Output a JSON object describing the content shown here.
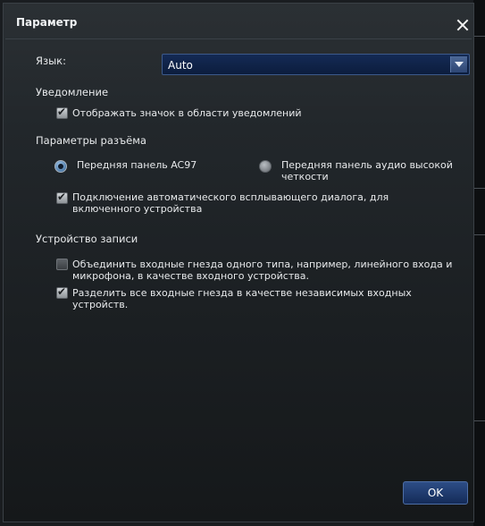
{
  "window": {
    "title": "Параметр"
  },
  "language": {
    "label": "Язык:",
    "selected": "Auto"
  },
  "notifications": {
    "heading": "Уведомление",
    "show_tray_icon": {
      "label": "Отображать значок в области уведомлений",
      "checked": true
    }
  },
  "jack_settings": {
    "heading": "Параметры разъёма",
    "front_ac97": {
      "label": "Передняя панель AC97",
      "selected": true
    },
    "front_hd": {
      "label": "Передняя панель аудио высокой четкости",
      "selected": false
    },
    "auto_popup": {
      "label": "Подключение автоматического всплывающего диалога, для включенного устройства",
      "checked": true
    }
  },
  "recording": {
    "heading": "Устройство записи",
    "combine_inputs": {
      "label": "Объединить входные гнезда одного типа, например, линейного входа и микрофона, в качестве входного устройства.",
      "checked": false
    },
    "separate_inputs": {
      "label": "Разделить все входные гнезда в качестве независимых входных устройств.",
      "checked": true
    }
  },
  "buttons": {
    "ok": "OK"
  }
}
